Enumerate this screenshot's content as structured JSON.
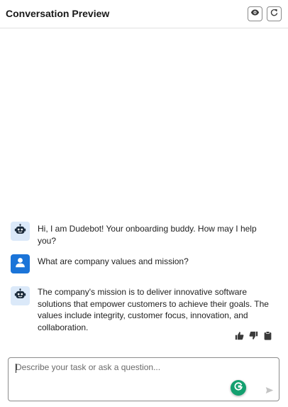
{
  "header": {
    "title": "Conversation Preview"
  },
  "messages": [
    {
      "role": "bot",
      "avatar_icon": "robot-icon",
      "text": "Hi, I am Dudebot! Your onboarding buddy. How may I help you?"
    },
    {
      "role": "user",
      "avatar_icon": "user-icon",
      "text": "What are company values and mission?"
    },
    {
      "role": "bot",
      "avatar_icon": "robot-icon",
      "text": "The company's mission is to deliver innovative software solutions that empower customers to achieve their goals. The values include integrity, customer focus, innovation, and collaboration."
    }
  ],
  "feedback_icons": [
    "thumbs-up-icon",
    "thumbs-down-icon",
    "clipboard-icon"
  ],
  "composer": {
    "placeholder": "Describe your task or ask a question...",
    "value": ""
  },
  "colors": {
    "bot_avatar_bg": "#dbe9f9",
    "user_avatar_bg": "#1b74d8",
    "grammarly_green": "#13a06f"
  }
}
